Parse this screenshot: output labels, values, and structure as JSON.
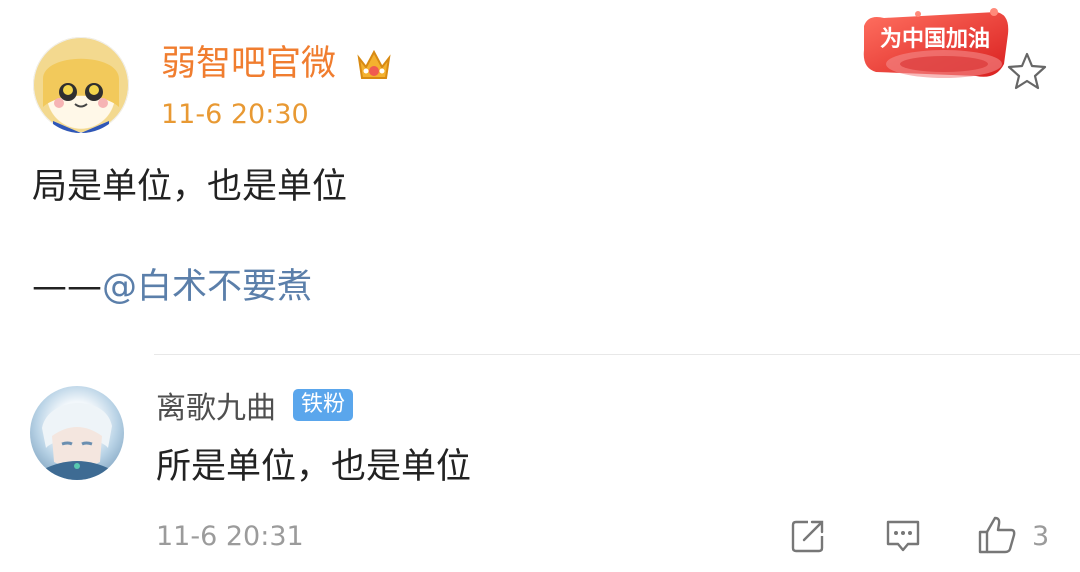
{
  "post": {
    "author": "弱智吧官微",
    "time": "11-6 20:30",
    "text": "局是单位，也是单位",
    "attribution_dash": "——",
    "mention": "@白术不要煮",
    "badge_text": "为中国加油"
  },
  "comment": {
    "author": "离歌九曲",
    "fan_badge": "铁粉",
    "text": "所是单位，也是单位",
    "time": "11-6 20:31",
    "like_count": "3"
  },
  "icons": {
    "crown": "crown-icon",
    "star": "star-outline-icon",
    "share": "share-icon",
    "reply": "comment-icon",
    "like": "thumbs-up-icon"
  },
  "colors": {
    "author_orange": "#f07d2f",
    "time_orange": "#e89933",
    "mention_blue": "#5b7faa",
    "fan_badge_blue": "#5aa6ec",
    "muted_gray": "#9b9b9b"
  }
}
